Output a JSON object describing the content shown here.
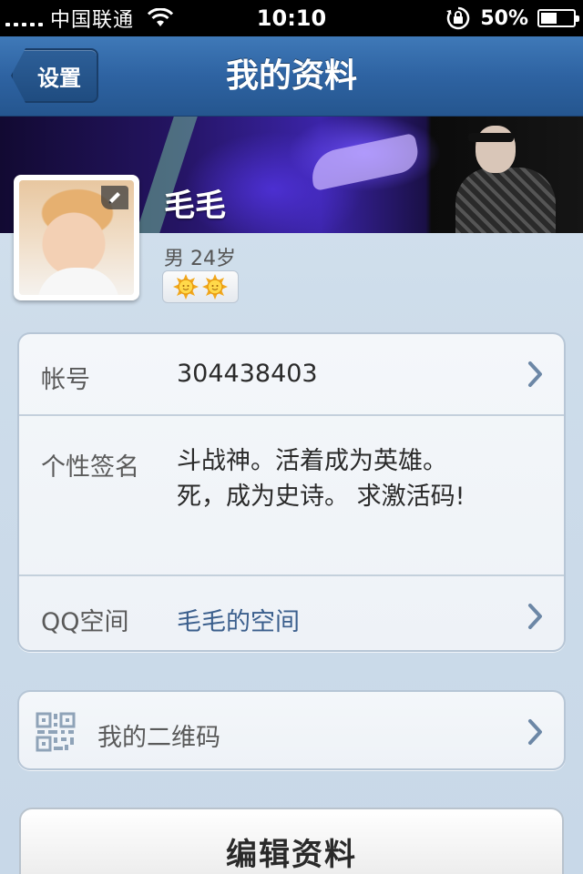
{
  "status_bar": {
    "carrier": "中国联通",
    "time": "10:10",
    "battery_percent_text": "50%",
    "battery_level": 0.5
  },
  "nav": {
    "back_label": "设置",
    "title": "我的资料"
  },
  "profile": {
    "name": "毛毛",
    "gender": "男",
    "age": "24岁",
    "level_icons": [
      "sun-icon",
      "sun-icon"
    ]
  },
  "info": {
    "account": {
      "label": "帐号",
      "value": "304438403"
    },
    "signature": {
      "label": "个性签名",
      "value": "斗战神。活着成为英雄。死，成为史诗。 求激活码!"
    },
    "qzone": {
      "label": "QQ空间",
      "value": "毛毛的空间"
    }
  },
  "qr": {
    "label": "我的二维码"
  },
  "edit_button_label": "编辑资料",
  "colors": {
    "nav_bar": "#2e63a2",
    "link_text": "#3a5e8c",
    "background": "#cddcea"
  }
}
